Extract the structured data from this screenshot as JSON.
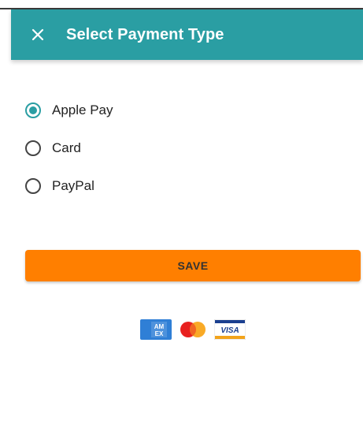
{
  "header": {
    "title": "Select Payment Type",
    "close_icon": "close-icon",
    "background": "#2a9ea3",
    "text_color": "#ffffff"
  },
  "payment_options": [
    {
      "label": "Apple Pay",
      "selected": true
    },
    {
      "label": "Card",
      "selected": false
    },
    {
      "label": "PayPal",
      "selected": false
    }
  ],
  "save_button": {
    "label": "SAVE",
    "background": "#ff7f00"
  },
  "accepted_cards": [
    {
      "name": "amex-icon",
      "text": "AM EX"
    },
    {
      "name": "mastercard-icon"
    },
    {
      "name": "visa-icon",
      "text": "VISA"
    }
  ],
  "accent_color": "#2a9ea3"
}
